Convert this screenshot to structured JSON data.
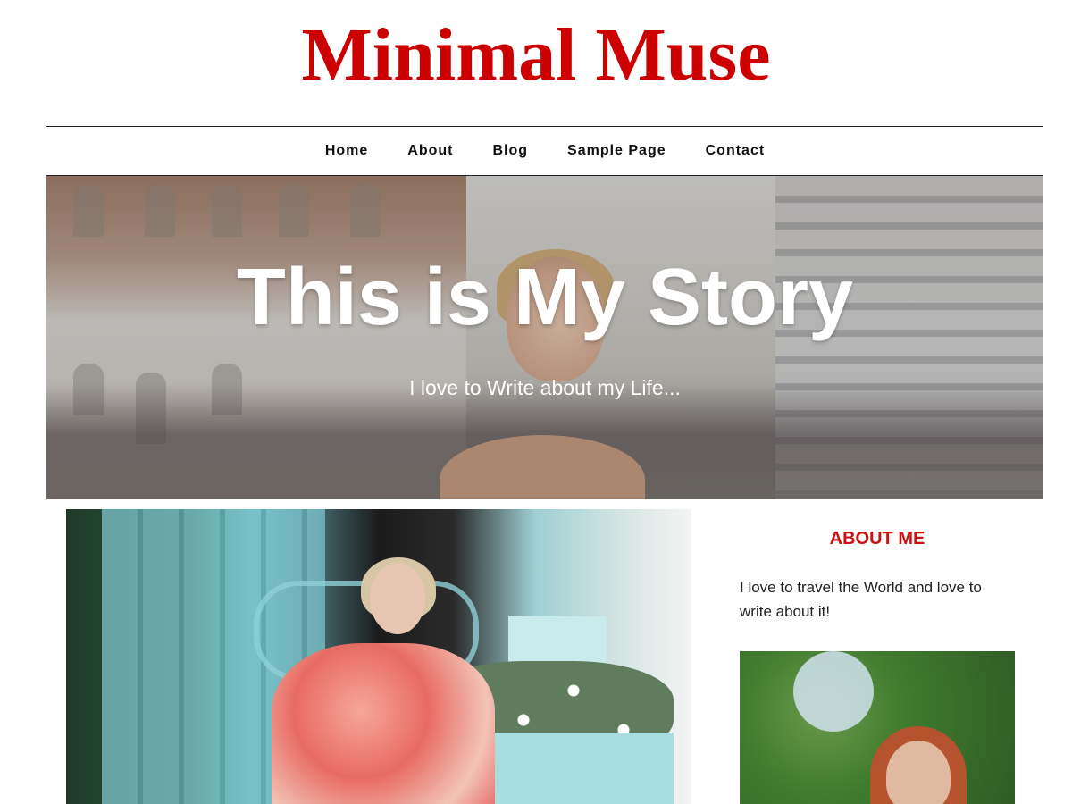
{
  "site": {
    "title": "Minimal Muse"
  },
  "nav": {
    "items": [
      "Home",
      "About",
      "Blog",
      "Sample Page",
      "Contact"
    ]
  },
  "hero": {
    "title": "This is My Story",
    "subtitle": "I love to Write about my Life..."
  },
  "sidebar": {
    "heading": "ABOUT ME",
    "text": "I love to travel the World and love to write about it!"
  },
  "colors": {
    "accent": "#cc0000",
    "nav_text": "#111111",
    "hero_text": "#ffffff"
  }
}
